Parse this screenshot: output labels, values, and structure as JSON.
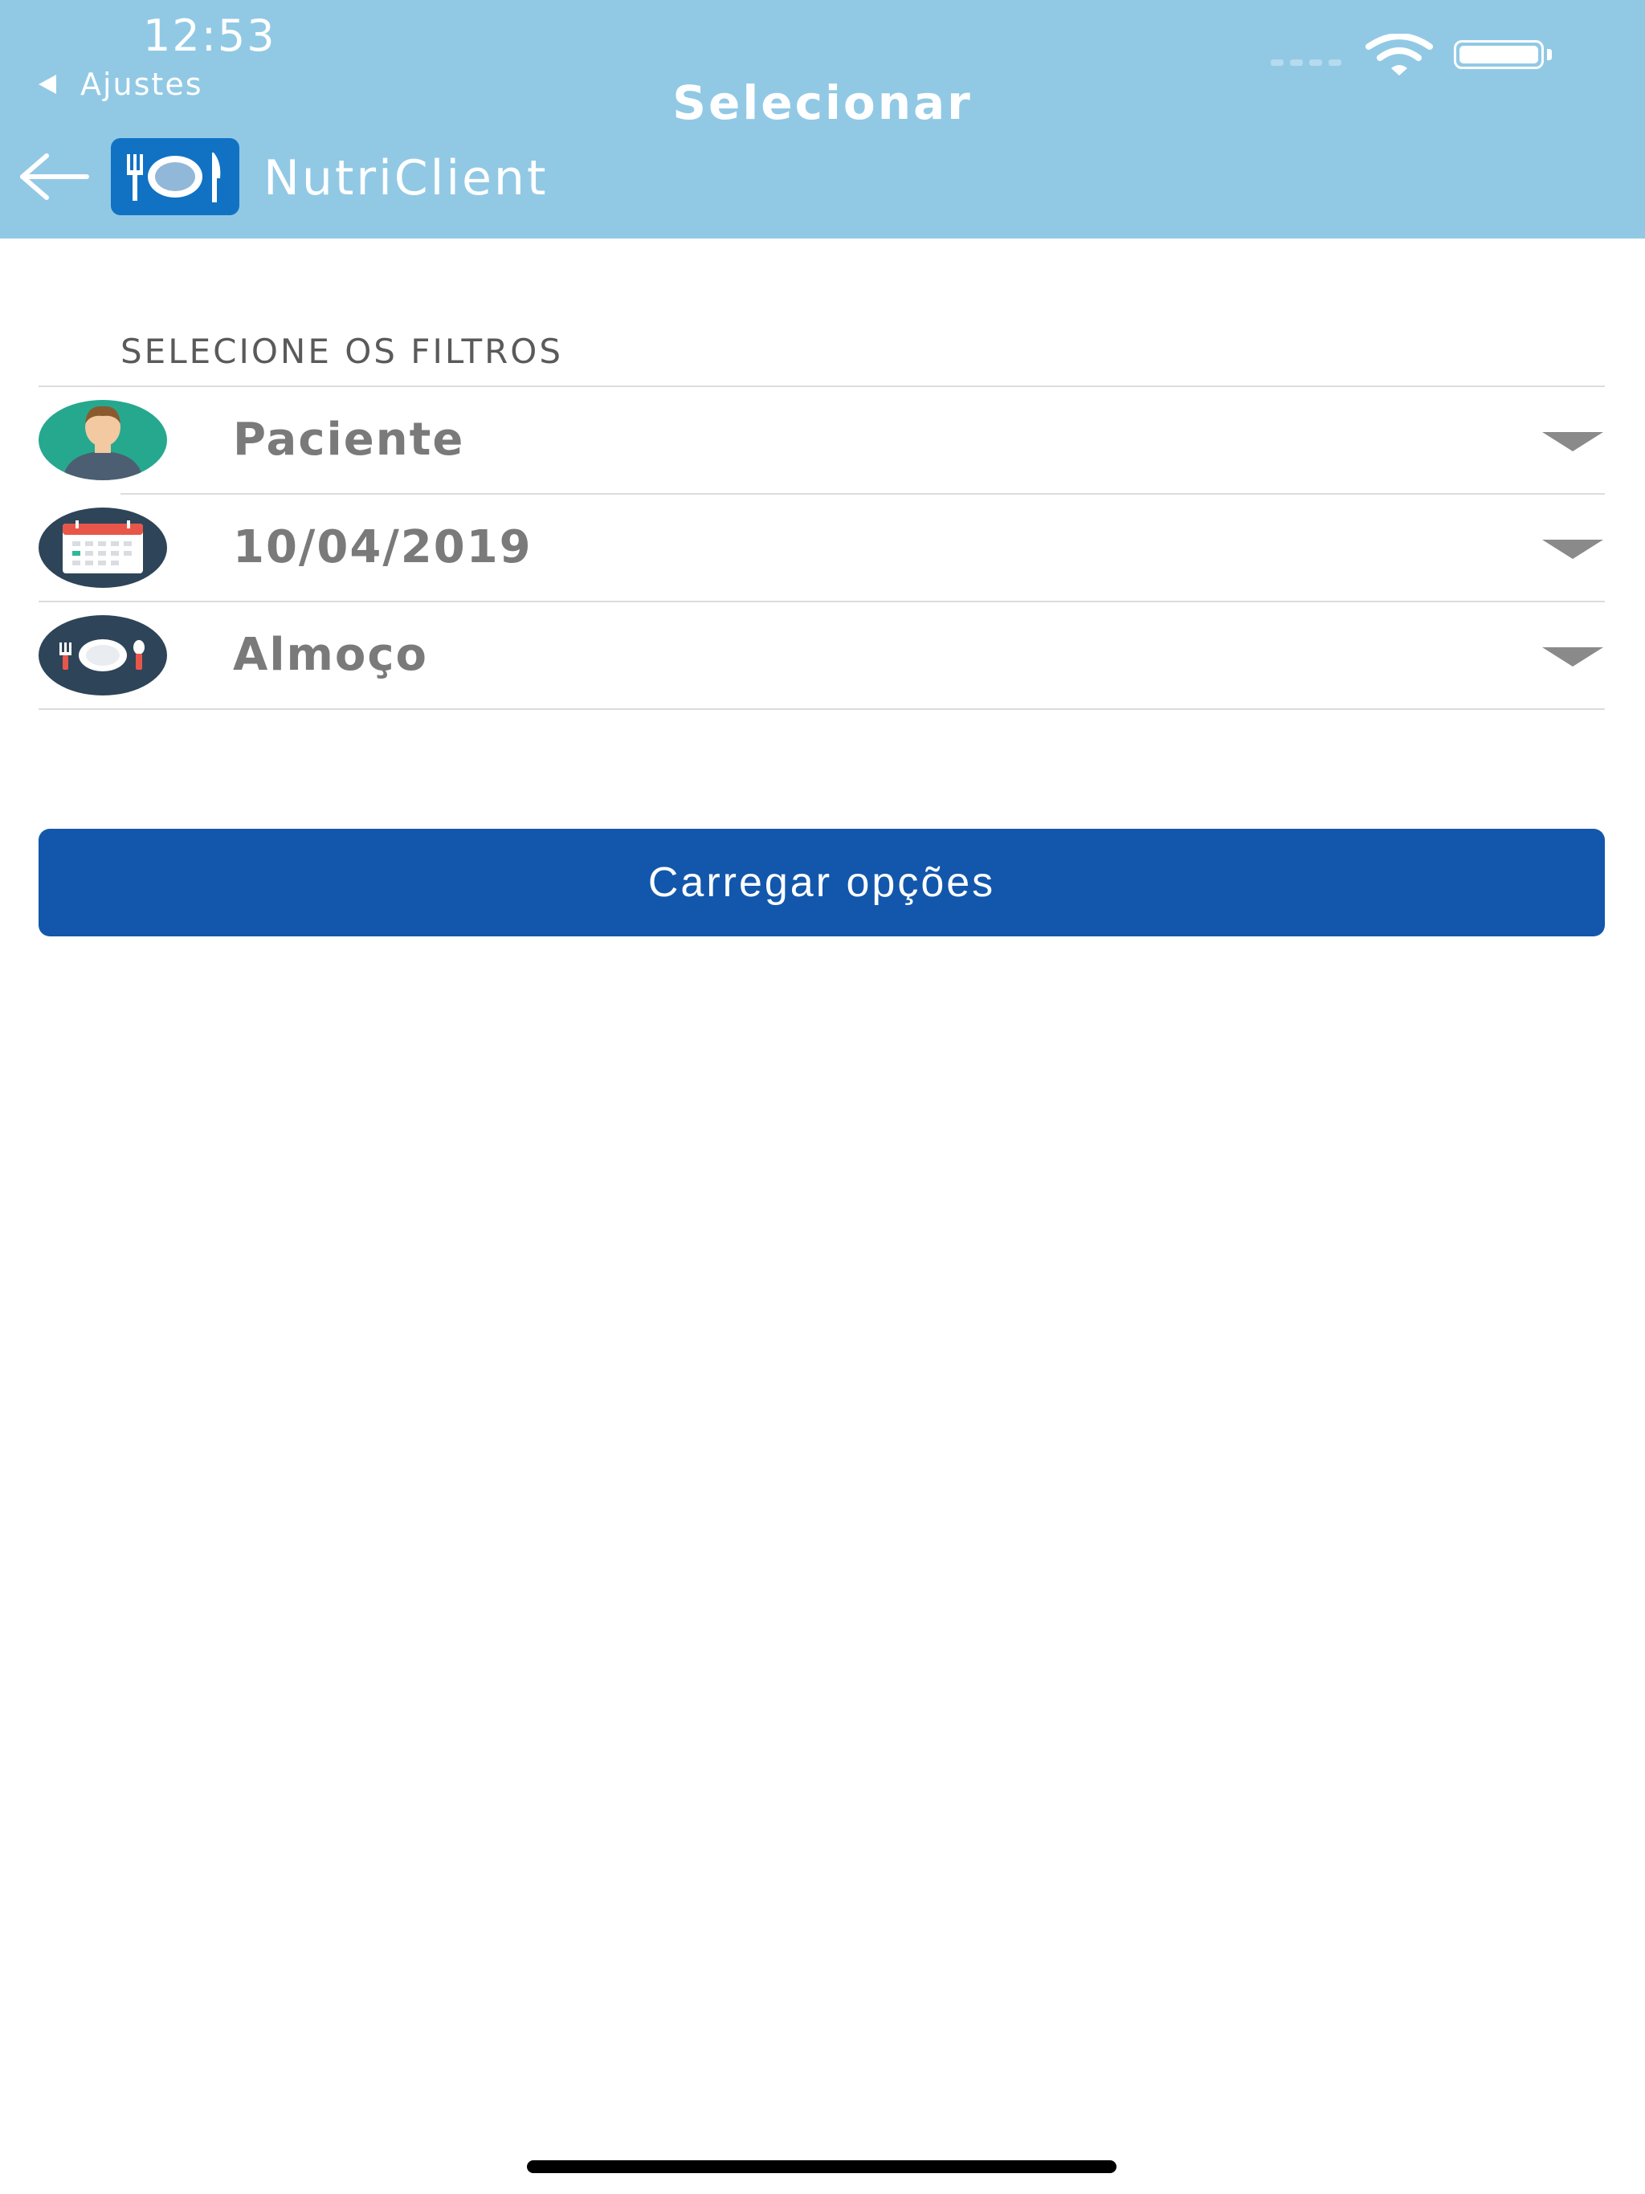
{
  "status_bar": {
    "time": "12:53",
    "back_app": "Ajustes"
  },
  "header": {
    "title": "Selecionar",
    "app_name": "NutriClient"
  },
  "filters": {
    "section_title": "SELECIONE OS FILTROS",
    "items": [
      {
        "label": "Paciente",
        "icon": "patient-avatar-icon"
      },
      {
        "label": "10/04/2019",
        "icon": "calendar-icon"
      },
      {
        "label": "Almoço",
        "icon": "plate-cutlery-icon"
      }
    ]
  },
  "actions": {
    "load_label": "Carregar opções"
  },
  "colors": {
    "header_bg": "#91c9e5",
    "button_bg": "#1257ab",
    "logo_bg": "#1172c4",
    "icon_dark_bg": "#2e4458",
    "avatar_bg": "#26a88f"
  }
}
